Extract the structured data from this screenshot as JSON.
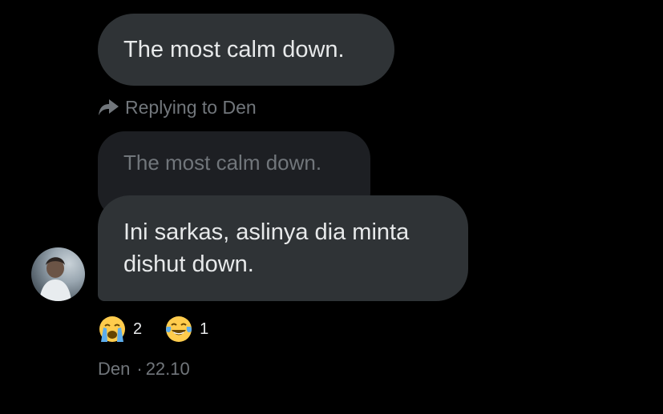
{
  "messages": {
    "top_bubble": "The most calm down.",
    "reply_label": "Replying to Den",
    "quoted_text": "The most calm down.",
    "main_bubble": "Ini sarkas, aslinya dia minta dishut down."
  },
  "reactions": [
    {
      "icon": "loudly-crying-face-icon",
      "count": "2"
    },
    {
      "icon": "face-with-tears-of-joy-icon",
      "count": "1"
    }
  ],
  "meta": {
    "sender": "Den",
    "separator": "·",
    "time": "22.10"
  },
  "colors": {
    "background": "#000000",
    "bubble": "#2f3336",
    "quoted_bubble": "#1d1f23",
    "primary_text": "#e7e9ea",
    "secondary_text": "#71767b"
  }
}
